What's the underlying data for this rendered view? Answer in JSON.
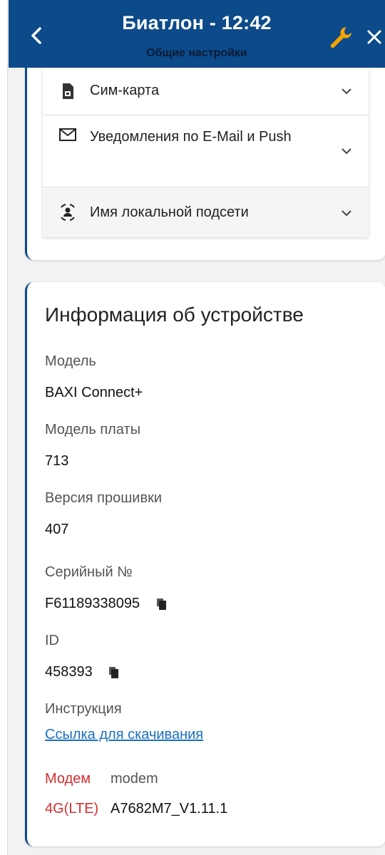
{
  "header": {
    "title": "Биатлон - 12:42",
    "subtitle": "Общие настройки",
    "icons": {
      "back": "chevron-left-icon",
      "wrench": "wrench-icon",
      "close": "close-icon"
    },
    "colors": {
      "background": "#0c4a8a",
      "wrench": "#f5a300"
    }
  },
  "settings": {
    "items": [
      {
        "label": "Сим-карта",
        "icon": "sim-card-icon"
      },
      {
        "label": "Уведомления по E-Mail и Push",
        "icon": "envelope-icon"
      },
      {
        "label": "Имя локальной подсети",
        "icon": "network-user-icon"
      }
    ]
  },
  "device_info": {
    "title": "Информация об устройстве",
    "model_label": "Модель",
    "model_value": "BAXI Connect+",
    "board_label": "Модель платы",
    "board_value": "713",
    "firmware_label": "Версия прошивки",
    "firmware_value": "407",
    "serial_label": "Серийный №",
    "serial_value": "F61189338095",
    "id_label": "ID",
    "id_value": "458393",
    "manual_label": "Инструкция",
    "manual_link": "Ссылка для скачивания",
    "modem_label": "Модем",
    "modem_value": "modem",
    "network_label": "4G(LTE)",
    "network_value": "A7682M7_V1.11.1"
  }
}
